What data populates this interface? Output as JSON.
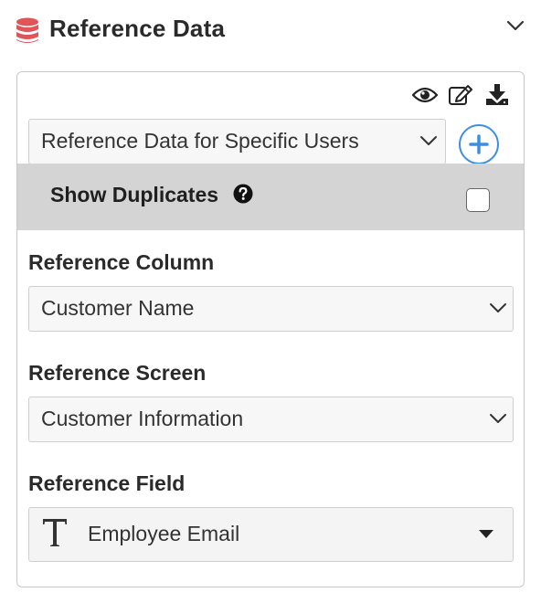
{
  "header": {
    "title": "Reference Data",
    "icon": "database-icon",
    "accent_color": "#e0555a"
  },
  "toolbar": {
    "icons": [
      "eye-icon",
      "edit-icon",
      "download-icon"
    ]
  },
  "dataset_select": {
    "value": "Reference Data for Specific Users"
  },
  "add_button": {
    "icon": "plus-icon",
    "color": "#3b8ee0"
  },
  "show_duplicates": {
    "label": "Show Duplicates",
    "checked": false
  },
  "fields": {
    "reference_column": {
      "label": "Reference Column",
      "value": "Customer Name"
    },
    "reference_screen": {
      "label": "Reference Screen",
      "value": "Customer Information"
    },
    "reference_field": {
      "label": "Reference Field",
      "value": "Employee Email",
      "type_icon": "text-type-icon"
    }
  }
}
